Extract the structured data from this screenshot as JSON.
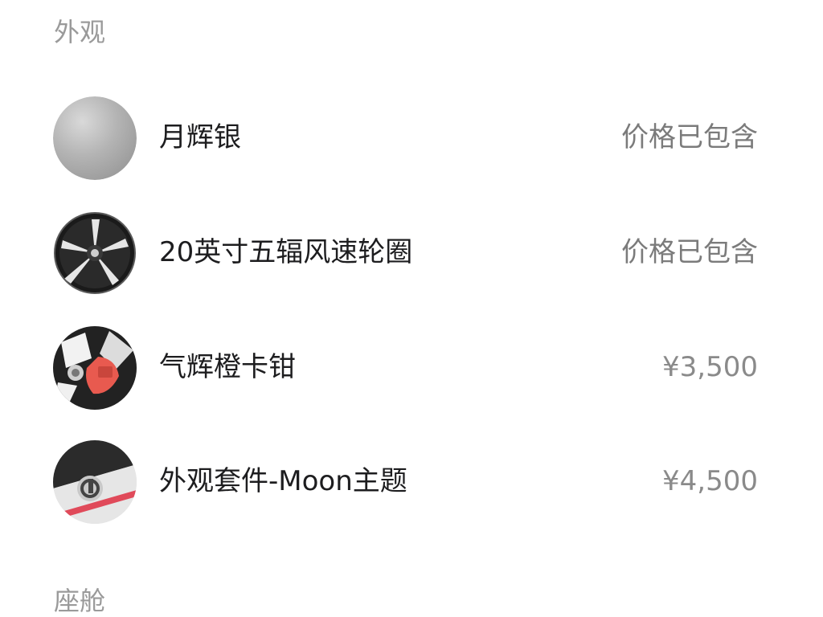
{
  "sections": {
    "exterior_title": "外观",
    "cabin_title": "座舱"
  },
  "exterior": {
    "items": [
      {
        "name": "月辉银",
        "price": "价格已包含",
        "icon": "silver-paint-swatch-icon"
      },
      {
        "name": "20英寸五辐风速轮圈",
        "price": "价格已包含",
        "icon": "wheel-rim-icon"
      },
      {
        "name": "气辉橙卡钳",
        "price": "¥3,500",
        "icon": "brake-caliper-icon"
      },
      {
        "name": "外观套件-Moon主题",
        "price": "¥4,500",
        "icon": "moon-theme-kit-icon"
      }
    ]
  },
  "colors": {
    "section_title": "#9a9a9a",
    "item_name": "#1d1d1f",
    "price": "#7b7b7b",
    "caliper_accent": "#e85a4f"
  }
}
